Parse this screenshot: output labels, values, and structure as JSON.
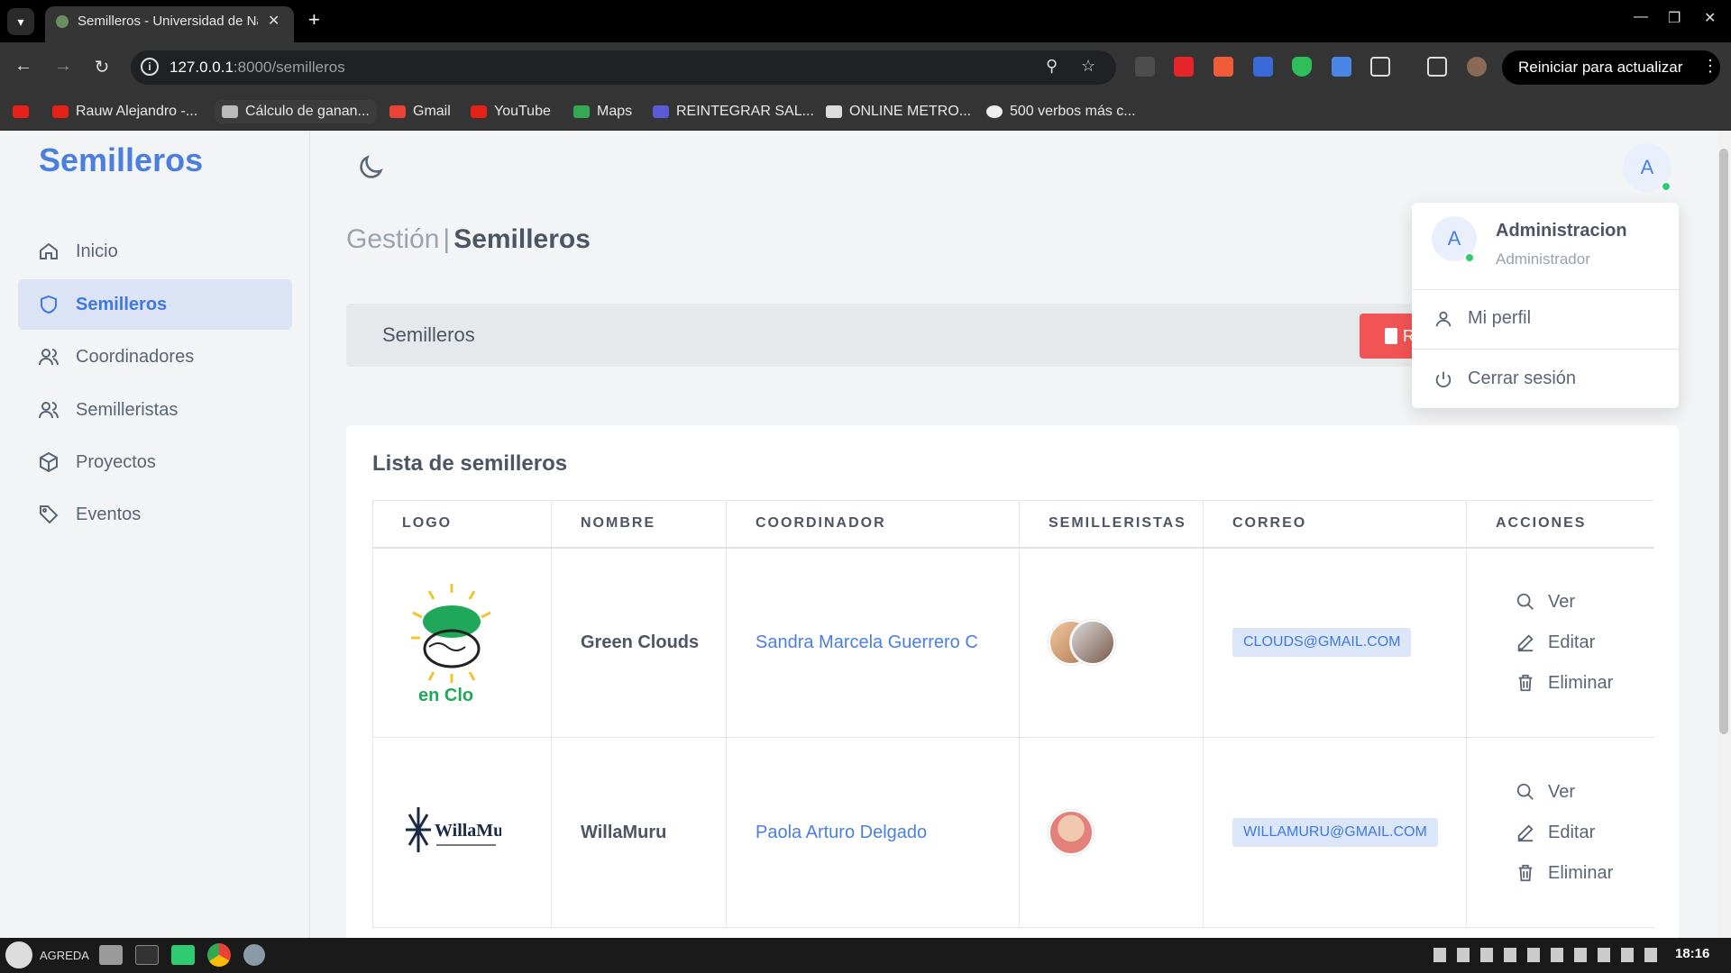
{
  "browser": {
    "tab_title": "Semilleros - Universidad de Nariño",
    "url_host": "127.0.0.1",
    "url_path": ":8000/semilleros",
    "restart_label": "Reiniciar para actualizar",
    "bookmarks": [
      {
        "label": "Rauw Alejandro -...",
        "icon": "youtube-icon"
      },
      {
        "label": "Cálculo de ganan...",
        "icon": "chart-icon"
      },
      {
        "label": "Gmail",
        "icon": "gmail-icon"
      },
      {
        "label": "YouTube",
        "icon": "youtube-icon"
      },
      {
        "label": "Maps",
        "icon": "maps-icon"
      },
      {
        "label": "REINTEGRAR SAL...",
        "icon": "doc-icon"
      },
      {
        "label": "ONLINE METRO...",
        "icon": "bars-icon"
      },
      {
        "label": "500 verbos más c...",
        "icon": "globe-icon"
      }
    ]
  },
  "sidebar": {
    "brand": "Semilleros",
    "items": [
      {
        "label": "Inicio",
        "icon": "home-icon",
        "active": false
      },
      {
        "label": "Semilleros",
        "icon": "shield-icon",
        "active": true
      },
      {
        "label": "Coordinadores",
        "icon": "users-icon",
        "active": false
      },
      {
        "label": "Semilleristas",
        "icon": "users-icon",
        "active": false
      },
      {
        "label": "Proyectos",
        "icon": "box-icon",
        "active": false
      },
      {
        "label": "Eventos",
        "icon": "tag-icon",
        "active": false
      }
    ]
  },
  "header": {
    "crumb_parent": "Gestión",
    "crumb_sep": "|",
    "crumb_current": "Semilleros",
    "avatar_letter": "A"
  },
  "panel": {
    "title": "Semilleros",
    "report_label": "R"
  },
  "card": {
    "title": "Lista de semilleros",
    "columns": [
      "LOGO",
      "NOMBRE",
      "COORDINADOR",
      "SEMILLERISTAS",
      "CORREO",
      "ACCIONES"
    ],
    "rows": [
      {
        "logo_text": "en Clo",
        "name": "Green Clouds",
        "coordinator": "Sandra Marcela Guerrero C",
        "email": "CLOUDS@GMAIL.COM"
      },
      {
        "logo_text": "WillaMuru",
        "name": "WillaMuru",
        "coordinator": "Paola Arturo Delgado",
        "email": "WILLAMURU@GMAIL.COM"
      }
    ],
    "actions": {
      "view": "Ver",
      "edit": "Editar",
      "delete": "Eliminar"
    }
  },
  "dropdown": {
    "avatar_letter": "A",
    "name": "Administracion",
    "role": "Administrador",
    "profile": "Mi perfil",
    "logout": "Cerrar sesión"
  },
  "taskbar": {
    "user": "AGREDA",
    "clock": "18:16"
  },
  "colors": {
    "accent": "#4a7fe0",
    "danger": "#f05454",
    "online": "#2ecc71"
  }
}
